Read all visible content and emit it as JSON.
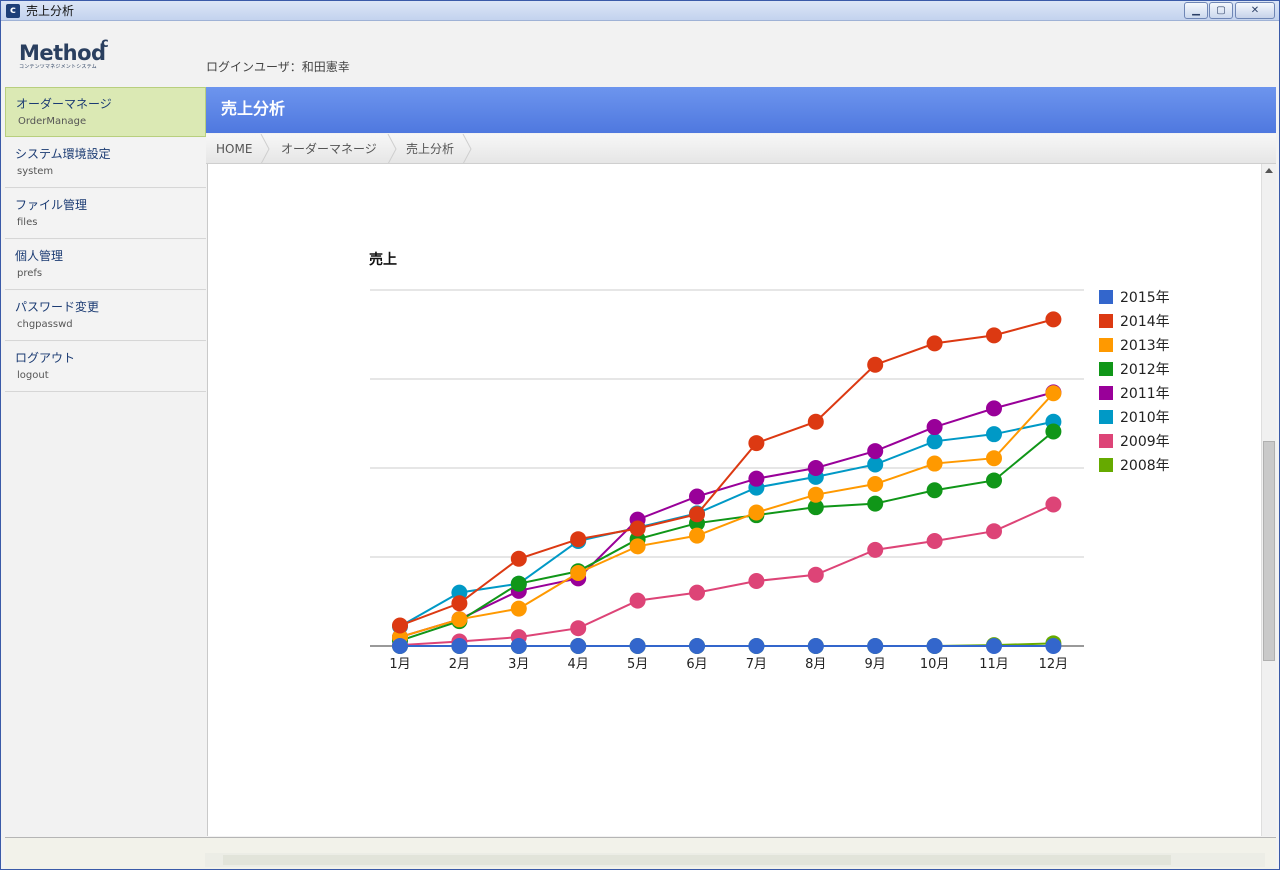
{
  "window": {
    "title": "売上分析",
    "icon_letter": "c"
  },
  "header": {
    "logo_text": "Method",
    "logo_mark": "c",
    "logo_sub": "コンテンツマネジメントシステム",
    "login_label": "ログインユーザ：和田憲幸"
  },
  "sidebar": {
    "items": [
      {
        "label": "オーダーマネージ",
        "sub": "OrderManage",
        "active": true
      },
      {
        "label": "システム環境設定",
        "sub": "system"
      },
      {
        "label": "ファイル管理",
        "sub": "files"
      },
      {
        "label": "個人管理",
        "sub": "prefs"
      },
      {
        "label": "パスワード変更",
        "sub": "chgpasswd"
      },
      {
        "label": "ログアウト",
        "sub": "logout"
      }
    ]
  },
  "page": {
    "title": "売上分析"
  },
  "breadcrumb": [
    "HOME",
    "オーダーマネージ",
    "売上分析"
  ],
  "chart_data": {
    "type": "line",
    "title": "売上",
    "xlabel": "",
    "ylabel": "",
    "categories": [
      "1月",
      "2月",
      "3月",
      "4月",
      "5月",
      "6月",
      "7月",
      "8月",
      "9月",
      "10月",
      "11月",
      "12月"
    ],
    "ylim": [
      0,
      40
    ],
    "grid": true,
    "legend": "right",
    "series": [
      {
        "name": "2015年",
        "color": "#3366cc",
        "values": [
          0,
          0,
          0,
          0,
          0,
          0,
          0,
          0,
          0,
          0,
          0,
          0
        ]
      },
      {
        "name": "2014年",
        "color": "#dc3912",
        "values": [
          2.3,
          4.8,
          9.8,
          12.0,
          13.2,
          14.8,
          22.8,
          25.2,
          31.6,
          34.0,
          34.9,
          36.7
        ]
      },
      {
        "name": "2013年",
        "color": "#ff9900",
        "values": [
          1.0,
          3.0,
          4.2,
          8.2,
          11.2,
          12.4,
          15.0,
          17.0,
          18.2,
          20.5,
          21.1,
          28.4
        ]
      },
      {
        "name": "2012年",
        "color": "#109618",
        "values": [
          0.6,
          2.8,
          7.0,
          8.4,
          12.0,
          13.8,
          14.7,
          15.6,
          16.0,
          17.5,
          18.6,
          24.1
        ]
      },
      {
        "name": "2011年",
        "color": "#990099",
        "values": [
          1.0,
          3.0,
          6.2,
          7.6,
          14.2,
          16.8,
          18.8,
          20.0,
          21.9,
          24.6,
          26.7,
          28.5
        ]
      },
      {
        "name": "2010年",
        "color": "#0099c6",
        "values": [
          2.2,
          6.0,
          7.0,
          11.8,
          13.3,
          14.9,
          17.8,
          19.0,
          20.4,
          23.0,
          23.8,
          25.2
        ]
      },
      {
        "name": "2009年",
        "color": "#dd4477",
        "values": [
          0.1,
          0.5,
          1.0,
          2.0,
          5.1,
          6.0,
          7.3,
          8.0,
          10.8,
          11.8,
          12.9,
          15.9
        ]
      },
      {
        "name": "2008年",
        "color": "#66aa00",
        "values": [
          0,
          0,
          0,
          0,
          0,
          0,
          0,
          0,
          0,
          0,
          0.1,
          0.3
        ]
      }
    ]
  }
}
